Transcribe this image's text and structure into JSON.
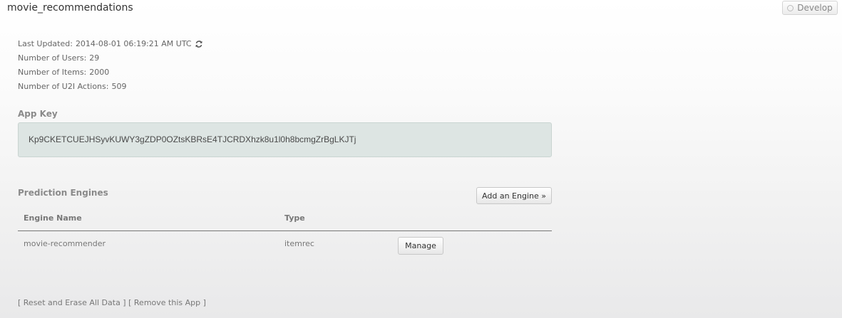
{
  "header": {
    "app_title": "movie_recommendations",
    "develop_label": "Develop"
  },
  "stats": {
    "last_updated_label": "Last Updated:",
    "last_updated_value": "2014-08-01 06:19:21 AM UTC",
    "users_label": "Number of Users:",
    "users_value": "29",
    "items_label": "Number of Items:",
    "items_value": "2000",
    "actions_label": "Number of U2I Actions:",
    "actions_value": "509"
  },
  "app_key": {
    "heading": "App Key",
    "value": "Kp9CKETCUEJHSyvKUWY3gZDP0OZtsKBRsE4TJCRDXhzk8u1l0h8bcmgZrBgLKJTj"
  },
  "engines": {
    "heading": "Prediction Engines",
    "add_button_label": "Add an Engine »",
    "columns": {
      "name": "Engine Name",
      "type": "Type"
    },
    "rows": [
      {
        "name": "movie-recommender",
        "type": "itemrec",
        "manage_label": "Manage"
      }
    ]
  },
  "footer": {
    "reset_label": "[ Reset and Erase All Data ]",
    "remove_label": "[ Remove this App ]"
  },
  "icons": {
    "refresh": "refresh-icon",
    "develop": "gear-icon"
  },
  "colors": {
    "app_key_background": "#dde5e3",
    "heading_text": "#8a8a8a"
  }
}
